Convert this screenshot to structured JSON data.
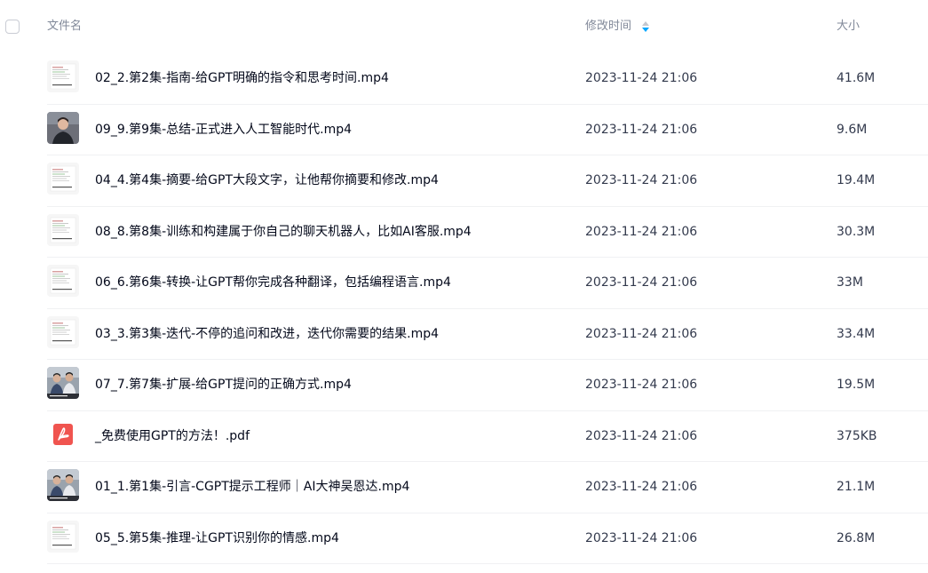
{
  "header": {
    "name_label": "文件名",
    "time_label": "修改时间",
    "size_label": "大小",
    "sort_icon": "sort-icon"
  },
  "colors": {
    "accent": "#06a7ff",
    "header_text": "#818999",
    "text": "#03081a",
    "pdf_red": "#f0544f"
  },
  "files": [
    {
      "name": "02_2.第2集-指南-给GPT明确的指令和思考时间.mp4",
      "time": "2023-11-24 21:06",
      "size": "41.6M",
      "thumb": "doc-thumbnail"
    },
    {
      "name": "09_9.第9集-总结-正式进入人工智能时代.mp4",
      "time": "2023-11-24 21:06",
      "size": "9.6M",
      "thumb": "person-thumbnail"
    },
    {
      "name": "04_4.第4集-摘要-给GPT大段文字，让他帮你摘要和修改.mp4",
      "time": "2023-11-24 21:06",
      "size": "19.4M",
      "thumb": "doc-thumbnail"
    },
    {
      "name": "08_8.第8集-训练和构建属于你自己的聊天机器人，比如AI客服.mp4",
      "time": "2023-11-24 21:06",
      "size": "30.3M",
      "thumb": "doc-thumbnail"
    },
    {
      "name": "06_6.第6集-转换-让GPT帮你完成各种翻译，包括编程语言.mp4",
      "time": "2023-11-24 21:06",
      "size": "33M",
      "thumb": "doc-thumbnail"
    },
    {
      "name": "03_3.第3集-迭代-不停的追问和改进，迭代你需要的结果.mp4",
      "time": "2023-11-24 21:06",
      "size": "33.4M",
      "thumb": "doc-thumbnail"
    },
    {
      "name": "07_7.第7集-扩展-给GPT提问的正确方式.mp4",
      "time": "2023-11-24 21:06",
      "size": "19.5M",
      "thumb": "two-people-thumbnail"
    },
    {
      "name": "_免费使用GPT的方法！.pdf",
      "time": "2023-11-24 21:06",
      "size": "375KB",
      "thumb": "pdf-icon"
    },
    {
      "name": "01_1.第1集-引言-CGPT提示工程师｜AI大神吴恩达.mp4",
      "time": "2023-11-24 21:06",
      "size": "21.1M",
      "thumb": "two-people-thumbnail"
    },
    {
      "name": "05_5.第5集-推理-让GPT识别你的情感.mp4",
      "time": "2023-11-24 21:06",
      "size": "26.8M",
      "thumb": "doc-thumbnail"
    }
  ]
}
